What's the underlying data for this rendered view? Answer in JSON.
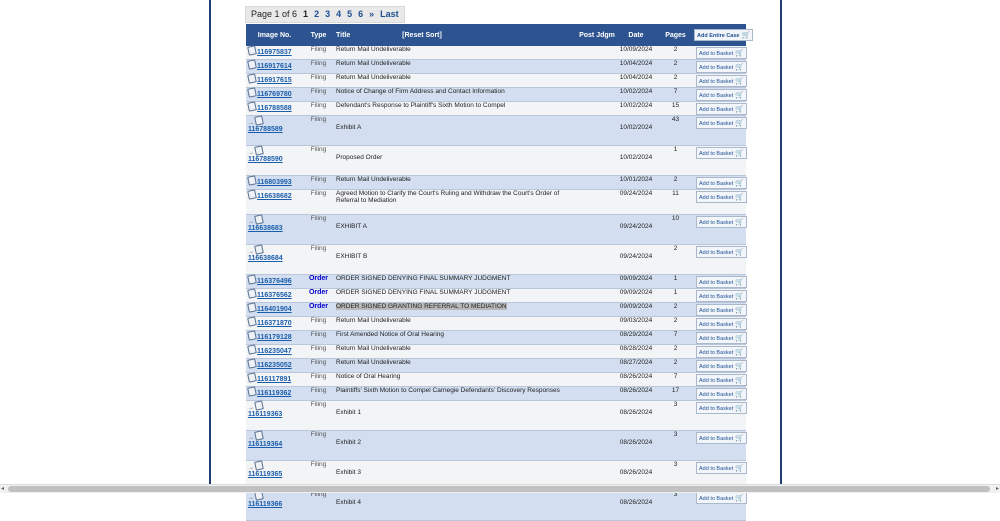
{
  "pager": {
    "label": "Page 1 of 6",
    "current": "1",
    "pages": [
      "2",
      "3",
      "4",
      "5",
      "6"
    ],
    "next": "»",
    "last": "Last"
  },
  "table": {
    "headers": {
      "image_no": "Image No.",
      "type": "Type",
      "title": "Title",
      "reset_sort": "[Reset Sort]",
      "post_jdgm": "Post Jdgm",
      "date": "Date",
      "pages": "Pages",
      "add_case": "Add Entire Case"
    },
    "add_basket_label": "Add to Basket",
    "rows": [
      {
        "image": "116975837",
        "type": "Filing",
        "title": "Return Mail Undeliverable",
        "date": "10/09/2024",
        "pages": "2"
      },
      {
        "image": "116917614",
        "type": "Filing",
        "title": "Return Mail Undeliverable",
        "date": "10/04/2024",
        "pages": "2"
      },
      {
        "image": "116917615",
        "type": "Filing",
        "title": "Return Mail Undeliverable",
        "date": "10/04/2024",
        "pages": "2"
      },
      {
        "image": "116769780",
        "type": "Filing",
        "title": "Notice of Change of Firm Address and Contact Information",
        "date": "10/02/2024",
        "pages": "7"
      },
      {
        "image": "116788588",
        "type": "Filing",
        "title": "Defendant's Response to Plaintiff's Sixth Motion to Compel",
        "date": "10/02/2024",
        "pages": "15"
      },
      {
        "image": "116788589",
        "type": "Filing",
        "title": "Exhibit A",
        "date": "10/02/2024",
        "pages": "43",
        "sub": true
      },
      {
        "image": "116788590",
        "type": "Filing",
        "title": "Proposed Order",
        "date": "10/02/2024",
        "pages": "1",
        "sub": true
      },
      {
        "image": "116803993",
        "type": "Filing",
        "title": "Return Mail Undeliverable",
        "date": "10/01/2024",
        "pages": "2"
      },
      {
        "image": "116638682",
        "type": "Filing",
        "title": "Agreed Motion to Clarify the Court's Ruling and Withdraw the Court's Order of Referral to Mediation",
        "date": "09/24/2024",
        "pages": "11"
      },
      {
        "image": "116638683",
        "type": "Filing",
        "title": "EXHIBIT A",
        "date": "09/24/2024",
        "pages": "10",
        "sub": true
      },
      {
        "image": "116638684",
        "type": "Filing",
        "title": "EXHIBIT B",
        "date": "09/24/2024",
        "pages": "2",
        "sub": true
      },
      {
        "image": "116376496",
        "type": "Order",
        "title": "ORDER SIGNED DENYING FINAL SUMMARY JUDGMENT",
        "date": "09/09/2024",
        "pages": "1"
      },
      {
        "image": "116376562",
        "type": "Order",
        "title": "ORDER SIGNED DENYING FINAL SUMMARY JUDGMENT",
        "date": "09/09/2024",
        "pages": "1"
      },
      {
        "image": "116401904",
        "type": "Order",
        "title": "ORDER SIGNED GRANTING REFERRAL TO MEDIATION",
        "date": "09/09/2024",
        "pages": "2",
        "highlight": true
      },
      {
        "image": "116371870",
        "type": "Filing",
        "title": "Return Mail Undeliverable",
        "date": "09/03/2024",
        "pages": "2"
      },
      {
        "image": "116179128",
        "type": "Filing",
        "title": "First Amended Notice of Oral Hearing",
        "date": "08/29/2024",
        "pages": "7"
      },
      {
        "image": "116235047",
        "type": "Filing",
        "title": "Return Mail Undeliverable",
        "date": "08/28/2024",
        "pages": "2"
      },
      {
        "image": "116235052",
        "type": "Filing",
        "title": "Return Mail Undeliverable",
        "date": "08/27/2024",
        "pages": "2"
      },
      {
        "image": "116117891",
        "type": "Filing",
        "title": "Notice of Oral Hearing",
        "date": "08/26/2024",
        "pages": "7"
      },
      {
        "image": "116119362",
        "type": "Filing",
        "title": "Plaintiffs' Sixth Motion to Compel Carnegie Defendants' Discovery Responses",
        "date": "08/26/2024",
        "pages": "17"
      },
      {
        "image": "116119363",
        "type": "Filing",
        "title": "Exhibit 1",
        "date": "08/26/2024",
        "pages": "3",
        "sub": true
      },
      {
        "image": "116119364",
        "type": "Filing",
        "title": "Exhibit 2",
        "date": "08/26/2024",
        "pages": "3",
        "sub": true
      },
      {
        "image": "116119365",
        "type": "Filing",
        "title": "Exhibit 3",
        "date": "08/26/2024",
        "pages": "3",
        "sub": true
      },
      {
        "image": "116119366",
        "type": "Filing",
        "title": "Exhibit 4",
        "date": "08/26/2024",
        "pages": "3",
        "sub": true
      }
    ]
  },
  "colors": {
    "header_bg": "#2d5490",
    "link": "#1a5dab",
    "order_type": "#0000cc",
    "row_even": "#d3dff0",
    "row_odd": "#f3f4f6",
    "frame_border": "#1f3d73"
  },
  "icons": {
    "document": "document-icon",
    "cart": "cart-icon",
    "sub_arrow": "sub-arrow-icon"
  }
}
